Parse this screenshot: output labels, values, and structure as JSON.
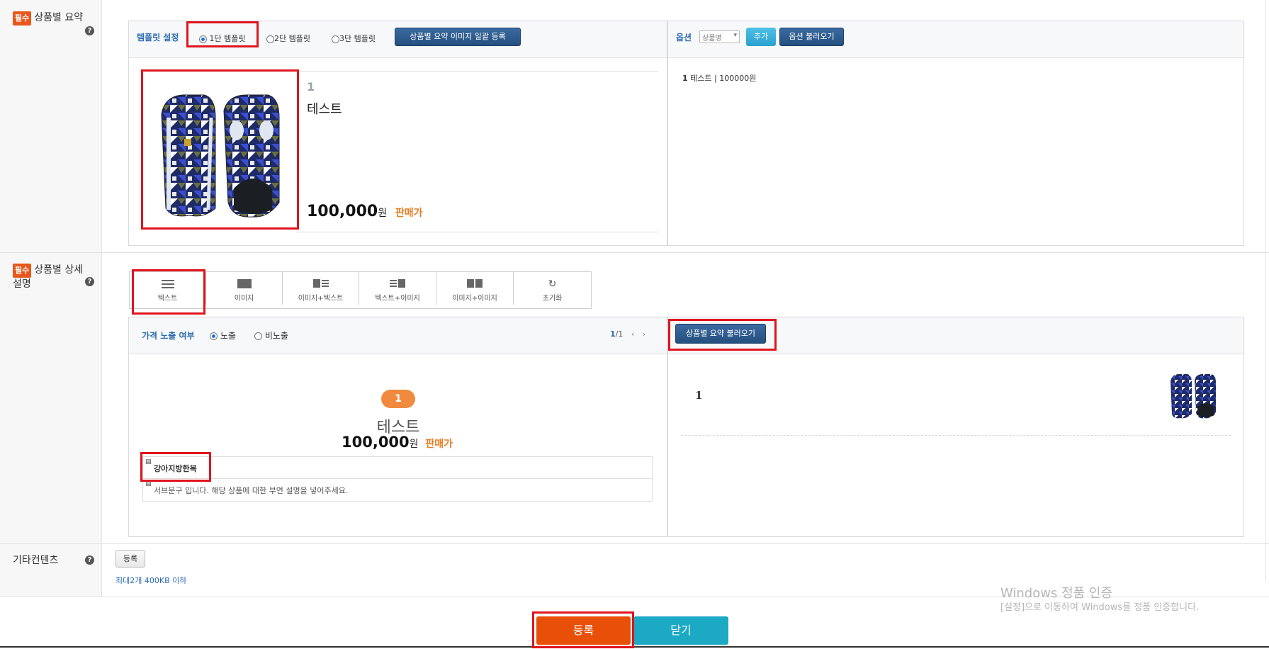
{
  "rows": {
    "summary": {
      "badge": "필수",
      "title": "상품별 요약"
    },
    "detail": {
      "badge": "필수",
      "title_line1": "상품별 상세",
      "title_line2": "설명"
    },
    "etc": {
      "title": "기타컨텐츠"
    }
  },
  "summary_panel": {
    "template_label": "템플릿 설정",
    "templates": [
      {
        "label": "1단 템플릿",
        "checked": true
      },
      {
        "label": "2단 템플릿",
        "checked": false
      },
      {
        "label": "3단 템플릿",
        "checked": false
      }
    ],
    "bulk_image_button": "상품별 요약 이미지 일괄 등록",
    "item_number": "1",
    "item_name": "테스트",
    "price": "100,000",
    "won": "원",
    "price_label": "판매가"
  },
  "option_panel": {
    "label": "옵션",
    "select_value": "상품명",
    "add_button": "추가",
    "load_button": "옵션 불러오기",
    "item_index": "1",
    "item_text": "테스트 | 100000원"
  },
  "toolbar": {
    "buttons": [
      {
        "label": "텍스트",
        "icon": "text-lines-icon"
      },
      {
        "label": "이미지",
        "icon": "image-block-icon"
      },
      {
        "label": "이미지+텍스트",
        "icon": "image-text-icon"
      },
      {
        "label": "텍스트+이미지",
        "icon": "text-image-icon"
      },
      {
        "label": "이미지+이미지",
        "icon": "image-image-icon"
      },
      {
        "label": "초기화",
        "icon": "refresh-icon"
      }
    ]
  },
  "detail_panel": {
    "price_visible_label": "가격 노출 여부",
    "show_label": "노출",
    "hide_label": "비노출",
    "pager": "1",
    "pager_total": "/1",
    "badge_number": "1",
    "name": "테스트",
    "price": "100,000",
    "won": "원",
    "price_label": "판매가",
    "main_text": "강아지방한복",
    "sub_text": "서브문구 입니다. 해당 상품에 대한 부연 설명을 넣어주세요."
  },
  "detail_right": {
    "load_summary_button": "상품별 요약 불러오기",
    "item_number": "1"
  },
  "etc": {
    "register_button": "등록",
    "note": "최대2개 400KB 이하"
  },
  "footer": {
    "submit_button": "등록",
    "close_button": "닫기"
  },
  "watermark": {
    "line1": "Windows 정품 인증",
    "line2": "[설정]으로 이동하여 Windows를 정품 인증합니다."
  },
  "colors": {
    "accent_orange": "#e8571c",
    "navy": "#24507f",
    "sky": "#2aa1cf",
    "highlight_red": "#e0141e"
  }
}
